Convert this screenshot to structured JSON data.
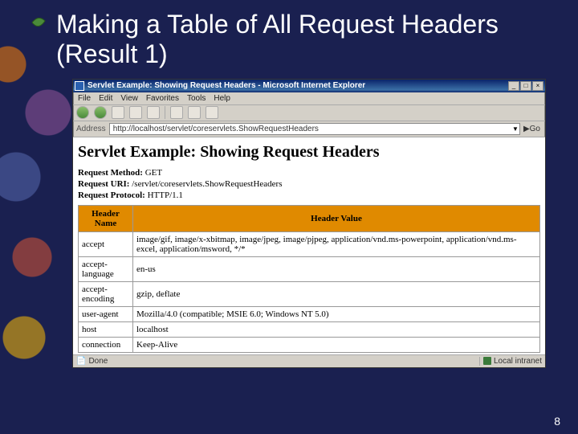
{
  "slide": {
    "title": "Making a Table of All Request Headers (Result 1)",
    "page_number": "8"
  },
  "browser": {
    "window_title": "Servlet Example: Showing Request Headers - Microsoft Internet Explorer",
    "menus": {
      "file": "File",
      "edit": "Edit",
      "view": "View",
      "favorites": "Favorites",
      "tools": "Tools",
      "help": "Help"
    },
    "address_label": "Address",
    "address_value": "http://localhost/servlet/coreservlets.ShowRequestHeaders",
    "go_label": "Go",
    "status_done": "Done",
    "status_zone": "Local intranet"
  },
  "page": {
    "heading": "Servlet Example: Showing Request Headers",
    "request_method_label": "Request Method:",
    "request_method_value": "GET",
    "request_uri_label": "Request URI:",
    "request_uri_value": "/servlet/coreservlets.ShowRequestHeaders",
    "request_protocol_label": "Request Protocol:",
    "request_protocol_value": "HTTP/1.1",
    "table": {
      "col_name": "Header Name",
      "col_value": "Header Value",
      "rows": [
        {
          "name": "accept",
          "value": "image/gif, image/x-xbitmap, image/jpeg, image/pjpeg, application/vnd.ms-powerpoint, application/vnd.ms-excel, application/msword, */*"
        },
        {
          "name": "accept-language",
          "value": "en-us"
        },
        {
          "name": "accept-encoding",
          "value": "gzip, deflate"
        },
        {
          "name": "user-agent",
          "value": "Mozilla/4.0 (compatible; MSIE 6.0; Windows NT 5.0)"
        },
        {
          "name": "host",
          "value": "localhost"
        },
        {
          "name": "connection",
          "value": "Keep-Alive"
        }
      ]
    }
  }
}
